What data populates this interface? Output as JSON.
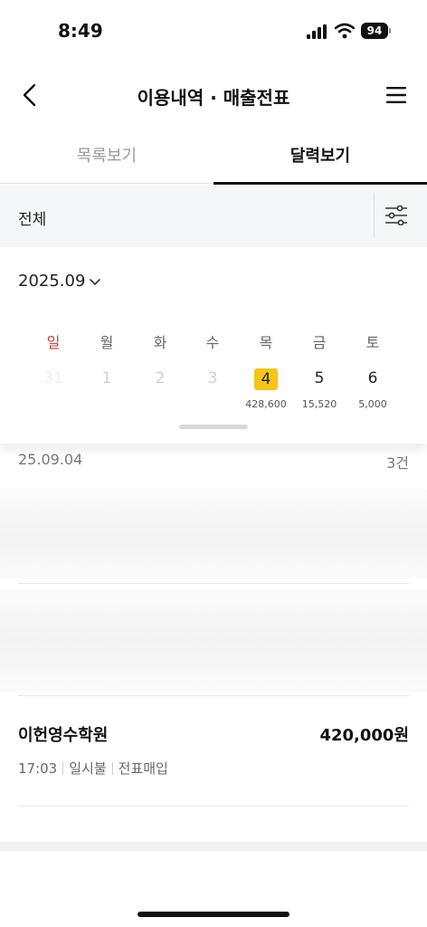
{
  "status": {
    "time": "8:49",
    "battery": "94"
  },
  "header": {
    "title": "이용내역 · 매출전표"
  },
  "tabs": [
    {
      "label": "목록보기"
    },
    {
      "label": "달력보기"
    }
  ],
  "filter": {
    "label": "전체"
  },
  "calendar": {
    "month": "2025.09",
    "weekdays": [
      "일",
      "월",
      "화",
      "수",
      "목",
      "금",
      "토"
    ],
    "days": [
      {
        "day": "31",
        "amount": ""
      },
      {
        "day": "1",
        "amount": ""
      },
      {
        "day": "2",
        "amount": ""
      },
      {
        "day": "3",
        "amount": ""
      },
      {
        "day": "4",
        "amount": "428,600",
        "selected": true
      },
      {
        "day": "5",
        "amount": "15,520"
      },
      {
        "day": "6",
        "amount": "5,000"
      }
    ],
    "selected_color": "#f5c518",
    "sunday_color": "#d43a3a"
  },
  "list": {
    "date": "25.09.04",
    "count": "3건",
    "item": {
      "merchant": "이헌영수학원",
      "amount": "420,000원",
      "time": "17:03",
      "payment": "일시불",
      "type": "전표매입"
    }
  }
}
